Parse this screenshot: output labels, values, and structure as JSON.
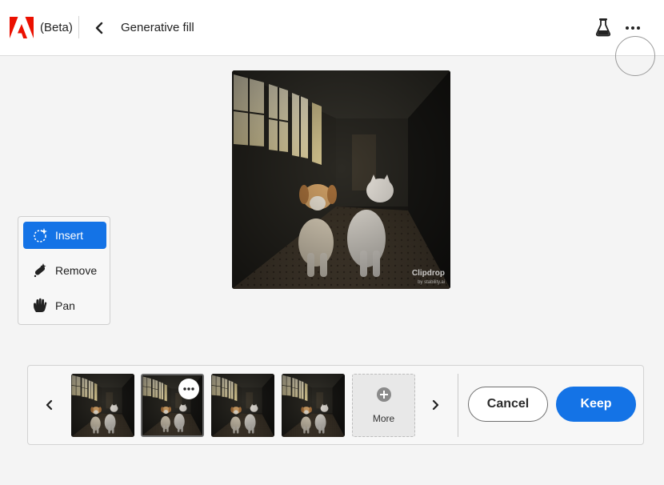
{
  "header": {
    "beta_label": "(Beta)",
    "title": "Generative fill",
    "icons": [
      "adobe-logo",
      "back-chevron",
      "flask-icon",
      "more-icon"
    ]
  },
  "main_image": {
    "watermark": "Clipdrop",
    "watermark_sub": "by stability.ai"
  },
  "tools": [
    {
      "label": "Insert",
      "icon": "insert-icon",
      "active": true
    },
    {
      "label": "Remove",
      "icon": "remove-icon",
      "active": false
    },
    {
      "label": "Pan",
      "icon": "pan-icon",
      "active": false
    }
  ],
  "variations": {
    "count": 4,
    "selected_index": 1,
    "more_label": "More"
  },
  "actions": {
    "cancel_label": "Cancel",
    "keep_label": "Keep"
  },
  "colors": {
    "accent": "#1473e6",
    "adobe_red": "#eb1000",
    "background": "#f4f4f4"
  }
}
